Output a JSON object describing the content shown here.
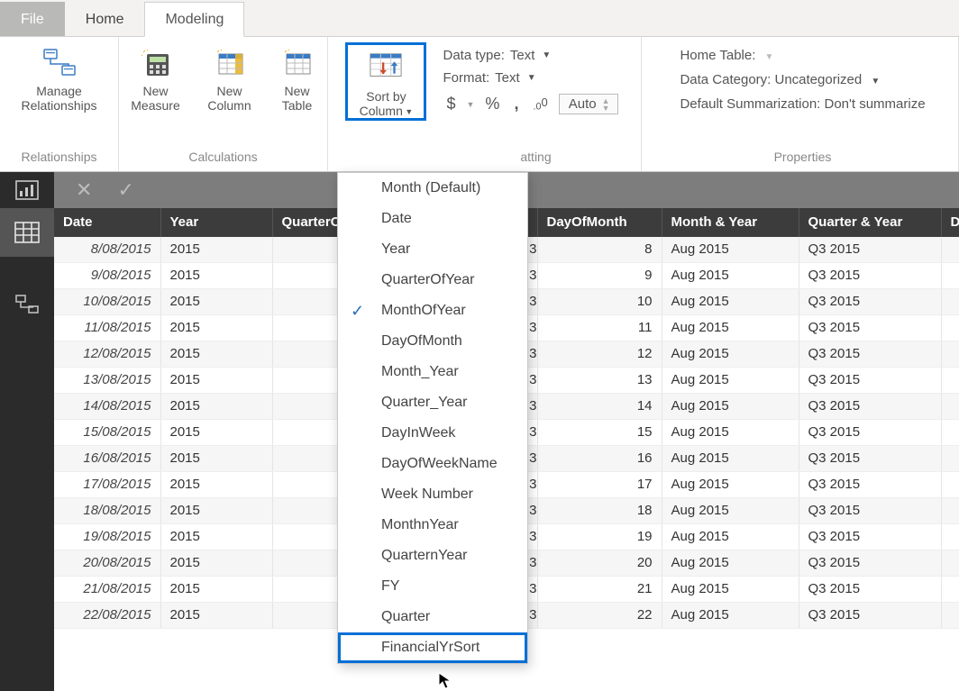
{
  "tabs": {
    "file": "File",
    "home": "Home",
    "modeling": "Modeling"
  },
  "ribbon": {
    "relationships": {
      "label": "Relationships",
      "manage": "Manage\nRelationships"
    },
    "calculations": {
      "label": "Calculations",
      "new_measure": "New\nMeasure",
      "new_column": "New\nColumn",
      "new_table": "New\nTable"
    },
    "sort_by_column": "Sort by\nColumn",
    "formatting": {
      "group_label": "atting",
      "data_type_label": "Data type:",
      "data_type_value": "Text",
      "format_label": "Format:",
      "format_value": "Text",
      "currency": "$",
      "percent": "%",
      "comma": ",",
      "decimal_btn": ".00",
      "auto": "Auto"
    },
    "properties": {
      "group_label": "Properties",
      "home_table": "Home Table:",
      "data_category_label": "Data Category:",
      "data_category_value": "Uncategorized",
      "default_summarization": "Default Summarization: Don't summarize"
    }
  },
  "sort_menu": {
    "items": [
      "Month (Default)",
      "Date",
      "Year",
      "QuarterOfYear",
      "MonthOfYear",
      "DayOfMonth",
      "Month_Year",
      "Quarter_Year",
      "DayInWeek",
      "DayOfWeekName",
      "Week Number",
      "MonthnYear",
      "QuarternYear",
      "FY",
      "Quarter",
      "FinancialYrSort"
    ],
    "checked_index": 4,
    "highlight_index": 15
  },
  "table": {
    "headers": [
      "Date",
      "Year",
      "QuarterO",
      "",
      "DayOfMonth",
      "Month & Year",
      "Quarter & Year",
      "D"
    ],
    "rows": [
      {
        "date": "8/08/2015",
        "year": "2015",
        "peek": "3",
        "dom": "8",
        "my": "Aug 2015",
        "qy": "Q3 2015"
      },
      {
        "date": "9/08/2015",
        "year": "2015",
        "peek": "3",
        "dom": "9",
        "my": "Aug 2015",
        "qy": "Q3 2015"
      },
      {
        "date": "10/08/2015",
        "year": "2015",
        "peek": "3",
        "dom": "10",
        "my": "Aug 2015",
        "qy": "Q3 2015"
      },
      {
        "date": "11/08/2015",
        "year": "2015",
        "peek": "3",
        "dom": "11",
        "my": "Aug 2015",
        "qy": "Q3 2015"
      },
      {
        "date": "12/08/2015",
        "year": "2015",
        "peek": "3",
        "dom": "12",
        "my": "Aug 2015",
        "qy": "Q3 2015"
      },
      {
        "date": "13/08/2015",
        "year": "2015",
        "peek": "3",
        "dom": "13",
        "my": "Aug 2015",
        "qy": "Q3 2015"
      },
      {
        "date": "14/08/2015",
        "year": "2015",
        "peek": "3",
        "dom": "14",
        "my": "Aug 2015",
        "qy": "Q3 2015"
      },
      {
        "date": "15/08/2015",
        "year": "2015",
        "peek": "3",
        "dom": "15",
        "my": "Aug 2015",
        "qy": "Q3 2015"
      },
      {
        "date": "16/08/2015",
        "year": "2015",
        "peek": "3",
        "dom": "16",
        "my": "Aug 2015",
        "qy": "Q3 2015"
      },
      {
        "date": "17/08/2015",
        "year": "2015",
        "peek": "3",
        "dom": "17",
        "my": "Aug 2015",
        "qy": "Q3 2015"
      },
      {
        "date": "18/08/2015",
        "year": "2015",
        "peek": "3",
        "dom": "18",
        "my": "Aug 2015",
        "qy": "Q3 2015"
      },
      {
        "date": "19/08/2015",
        "year": "2015",
        "peek": "3",
        "dom": "19",
        "my": "Aug 2015",
        "qy": "Q3 2015"
      },
      {
        "date": "20/08/2015",
        "year": "2015",
        "peek": "3",
        "dom": "20",
        "my": "Aug 2015",
        "qy": "Q3 2015"
      },
      {
        "date": "21/08/2015",
        "year": "2015",
        "peek": "3",
        "dom": "21",
        "my": "Aug 2015",
        "qy": "Q3 2015"
      },
      {
        "date": "22/08/2015",
        "year": "2015",
        "peek": "3",
        "dom": "22",
        "my": "Aug 2015",
        "qy": "Q3 2015"
      }
    ]
  }
}
